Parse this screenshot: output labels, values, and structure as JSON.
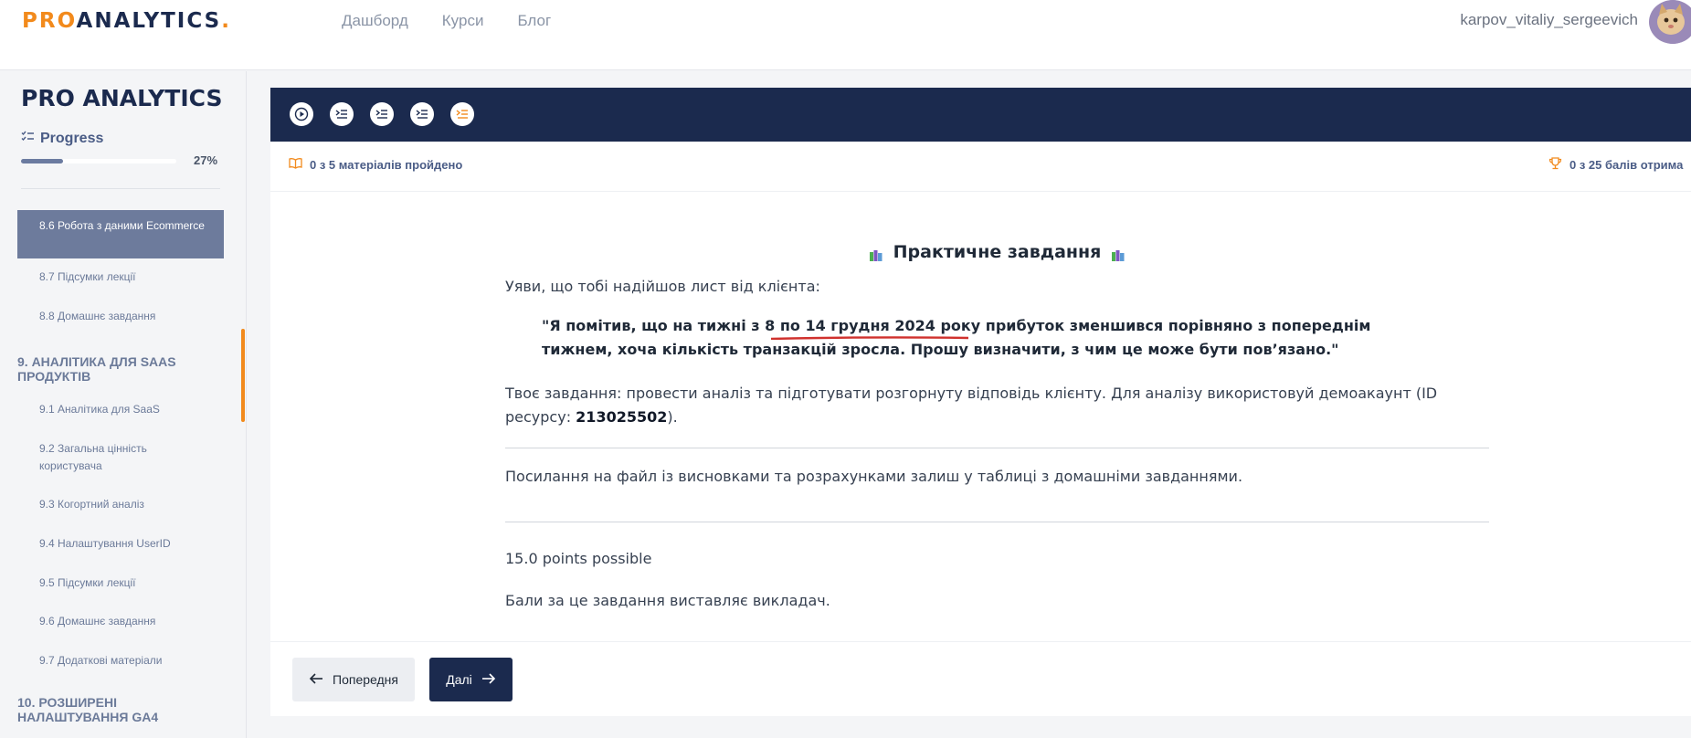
{
  "header": {
    "logo_pro": "PRO",
    "logo_analytics": "ANALYTICS",
    "logo_dot": ".",
    "nav": [
      "Дашборд",
      "Курси",
      "Блог"
    ],
    "username": "karpov_vitaliy_sergeevich"
  },
  "sidebar": {
    "title": "PRO ANALYTICS",
    "progress_label": "Progress",
    "progress_value": 0.27,
    "progress_pct": "27%",
    "items": [
      {
        "label": "8.6 Робота з даними Ecommerce",
        "active": true
      },
      {
        "label": "8.7 Підсумки лекції"
      },
      {
        "label": "8.8 Домашнє завдання"
      },
      {
        "label": "9.1 Аналітика для SaaS"
      },
      {
        "label": "9.2 Загальна цінність користувача"
      },
      {
        "label": "9.3 Когортний аналіз"
      },
      {
        "label": "9.4 Налаштування UserID"
      },
      {
        "label": "9.5 Підсумки лекції"
      },
      {
        "label": "9.6 Домашнє завдання"
      },
      {
        "label": "9.7 Додаткові матеріали"
      }
    ],
    "sections": [
      "9. АНАЛІТИКА ДЛЯ SAAS ПРОДУКТІВ",
      "10. РОЗШИРЕНІ НАЛАШТУВАННЯ GA4"
    ]
  },
  "toolbar": {
    "icons": [
      "play-circle-icon",
      "list-icon",
      "list-icon",
      "list-icon",
      "list-icon-active"
    ],
    "accent": "#f28a1c"
  },
  "stats": {
    "materials": "0 з 5 матеріалів пройдено",
    "points": "0 з 25 балів отрима"
  },
  "task": {
    "title": "Практичне завдання",
    "intro": "Уяви, що тобі надійшов лист від клієнта:",
    "quote": "\"Я помітив, що на тижні з 8 по 14 грудня 2024 року прибуток зменшився порівняно з попереднім тижнем, хоча кількість транзакцій зросла. Прошу визначити, з чим це може бути пов’язано.\"",
    "body_text": "Твоє завдання: провести аналіз та підготувати розгорнуту відповідь клієнту. Для аналізу використовуй демоакаунт (ID ресурсу: ",
    "resource_id": "213025502",
    "body_end": ").",
    "link_text": "Посилання на файл із висновками та розрахунками залиш у таблиці з домашніми завданнями.",
    "points_possible": "15.0 points possible",
    "grader": "Бали за це завдання виставляє викладач."
  },
  "nav_buttons": {
    "prev": "Попередня",
    "next": "Далі"
  },
  "colors": {
    "navy": "#1b2a4e",
    "orange": "#f28a1c",
    "underline": "#d0312d"
  }
}
